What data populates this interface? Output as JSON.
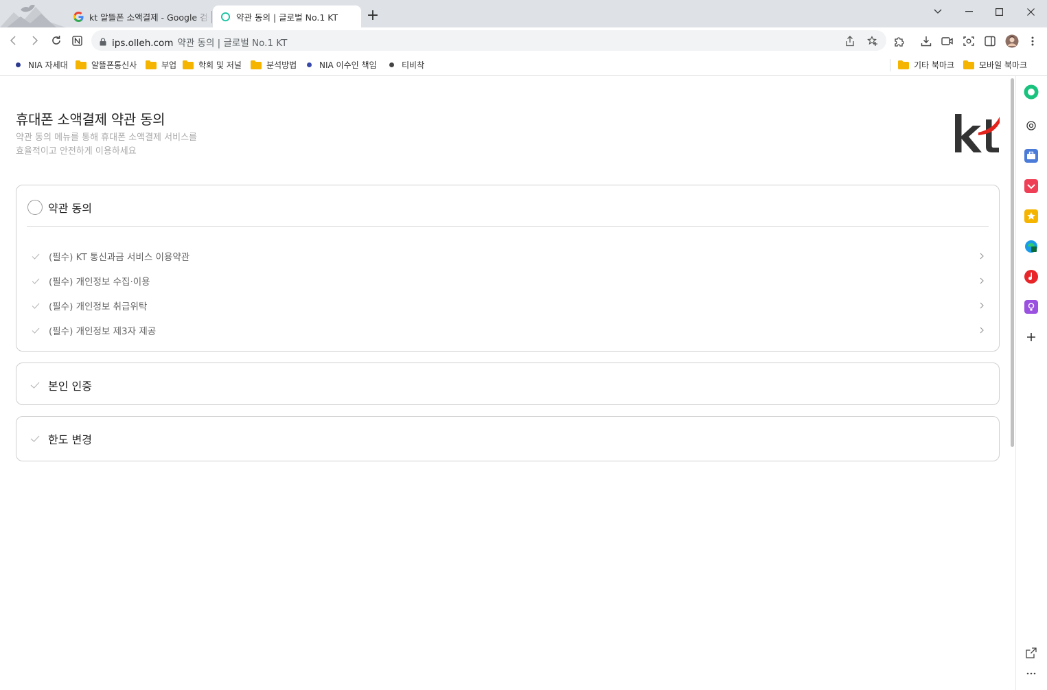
{
  "browser": {
    "tabs": [
      {
        "title": "kt 알뜰폰 소액결제 - Google 검색",
        "favicon": "google-icon",
        "active": false
      },
      {
        "title": "약관 동의 | 글로벌 No.1 KT",
        "favicon": "kt-ring-icon",
        "active": true
      }
    ],
    "address": {
      "domain": "ips.olleh.com",
      "page_title": "약관 동의 | 글로벌 No.1 KT"
    },
    "bookmarks_left": [
      {
        "label": "NIA 자세대",
        "icon": "dot",
        "color": "#2b3a8f"
      },
      {
        "label": "알뜰폰통신사",
        "icon": "folder"
      },
      {
        "label": "부업",
        "icon": "folder"
      },
      {
        "label": "학회 및 저널",
        "icon": "folder"
      },
      {
        "label": "분석방법",
        "icon": "folder"
      },
      {
        "label": "NIA 이수인 책임",
        "icon": "dot",
        "color": "#3949ab"
      },
      {
        "label": "티비착",
        "icon": "dot",
        "color": "#444444"
      }
    ],
    "bookmarks_right": [
      {
        "label": "기타 북마크",
        "icon": "folder"
      },
      {
        "label": "모바일 북마크",
        "icon": "folder"
      }
    ]
  },
  "page": {
    "title": "휴대폰 소액결제 약관 동의",
    "subtitle_line1": "약관 동의 메뉴를 통해 휴대폰 소액결제 서비스를",
    "subtitle_line2": "효율적이고 안전하게 이용하세요",
    "logo_alt": "kt"
  },
  "terms_section": {
    "heading": "약관 동의",
    "items": [
      {
        "label": "(필수) KT 통신과금 서비스 이용약관"
      },
      {
        "label": "(필수) 개인정보 수집·이용"
      },
      {
        "label": "(필수) 개인정보 취급위탁"
      },
      {
        "label": "(필수) 개인정보 제3자 제공"
      }
    ]
  },
  "auth_section": {
    "heading": "본인 인증"
  },
  "limit_section": {
    "heading": "한도 변경"
  },
  "colors": {
    "kt_red": "#e4221c",
    "kt_dark": "#333333",
    "folder": "#f4b400"
  }
}
